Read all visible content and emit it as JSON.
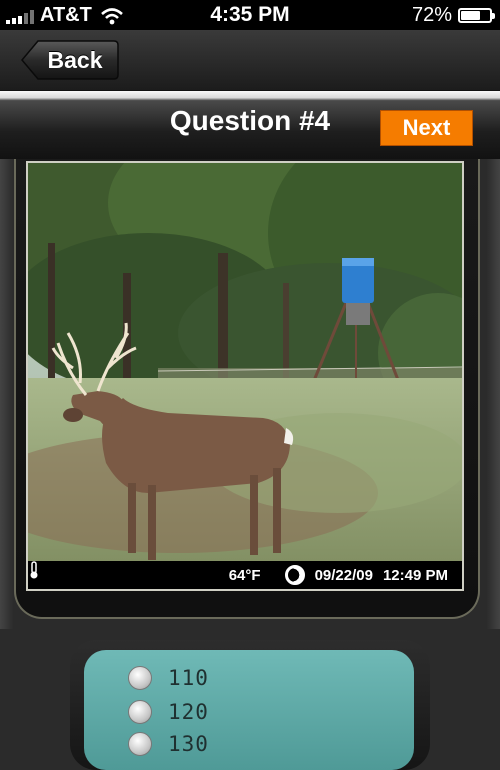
{
  "status_bar": {
    "carrier": "AT&T",
    "time": "4:35 PM",
    "battery_percent": "72%",
    "battery_level": 0.72
  },
  "nav": {
    "back_label": "Back"
  },
  "question": {
    "title": "Question #4",
    "next_label": "Next"
  },
  "photo": {
    "temperature": "64°F",
    "date": "09/22/09",
    "time": "12:49 PM"
  },
  "answers": {
    "options": [
      "110",
      "120",
      "130"
    ]
  },
  "colors": {
    "accent_orange": "#f57c00",
    "answer_panel": "#5fa9a6"
  }
}
